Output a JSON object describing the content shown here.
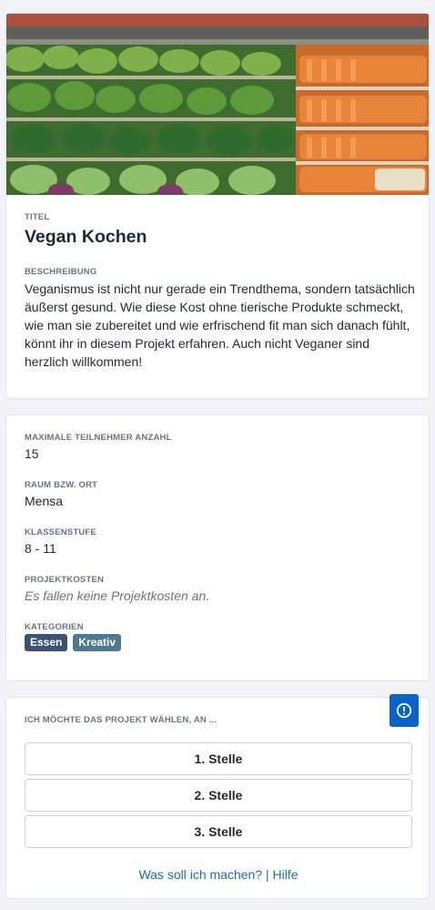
{
  "project": {
    "title_label": "TITEL",
    "title": "Vegan Kochen",
    "description_label": "BESCHREIBUNG",
    "description": "Veganismus ist nicht nur gerade ein Trendthema, sondern tatsächlich äußerst gesund. Wie diese Kost ohne tierische Produkte schmeckt, wie man sie zubereitet und wie erfrischend fit man sich danach fühlt, könnt ihr in diesem Projekt erfahren. Auch nicht Veganer sind herzlich willkommen!"
  },
  "details": {
    "max_participants_label": "MAXIMALE TEILNEHMER ANZAHL",
    "max_participants": "15",
    "room_label": "RAUM BZW. ORT",
    "room": "Mensa",
    "grade_label": "KLASSENSTUFE",
    "grade": "8 - 11",
    "cost_label": "PROJEKTKOSTEN",
    "cost": "Es fallen keine Projektkosten an.",
    "categories_label": "KATEGORIEN",
    "categories": [
      {
        "label": "Essen",
        "color": "#3a5273"
      },
      {
        "label": "Kreativ",
        "color": "#4f7892"
      }
    ]
  },
  "choice": {
    "heading": "ICH MÖCHTE DAS PROJEKT WÄHLEN, AN ...",
    "options": [
      "1. Stelle",
      "2. Stelle",
      "3. Stelle"
    ],
    "help_link": "Was soll ich machen? | Hilfe"
  },
  "icons": {
    "info": "exclamation-circle-icon",
    "hero": "vegetable-shelf-image"
  },
  "colors": {
    "accent": "#0a64c8",
    "link": "#1d6fa6",
    "label": "#687489"
  }
}
